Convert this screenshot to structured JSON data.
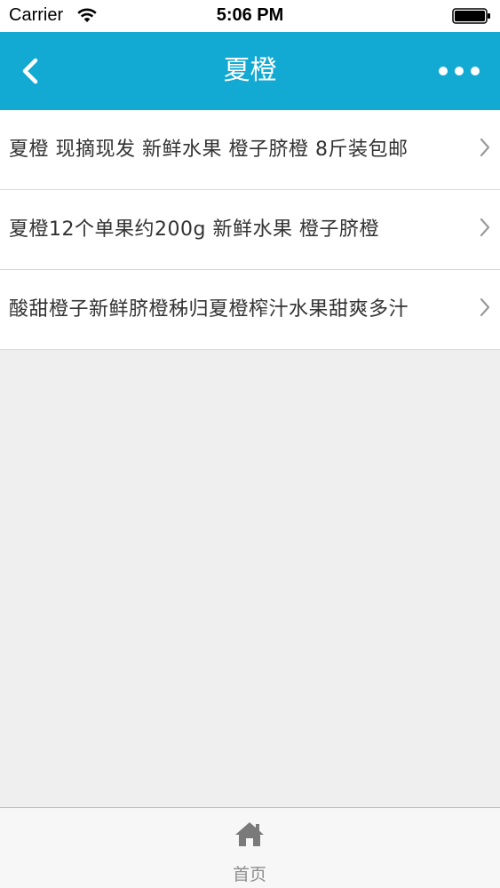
{
  "status_bar": {
    "carrier": "Carrier",
    "time": "5:06 PM",
    "icons": [
      "wifi-icon",
      "battery-icon"
    ]
  },
  "nav": {
    "title": "夏橙",
    "back_icon": "chevron-left-icon",
    "more_icon": "more-dots-icon",
    "color": "#12a9d3"
  },
  "list": {
    "items": [
      {
        "label": "夏橙 现摘现发 新鲜水果 橙子脐橙 8斤装包邮"
      },
      {
        "label": "夏橙12个单果约200g 新鲜水果 橙子脐橙"
      },
      {
        "label": "酸甜橙子新鲜脐橙秭归夏橙榨汁水果甜爽多汁"
      }
    ]
  },
  "tab_bar": {
    "tabs": [
      {
        "label": "首页",
        "icon": "home-icon"
      }
    ]
  }
}
